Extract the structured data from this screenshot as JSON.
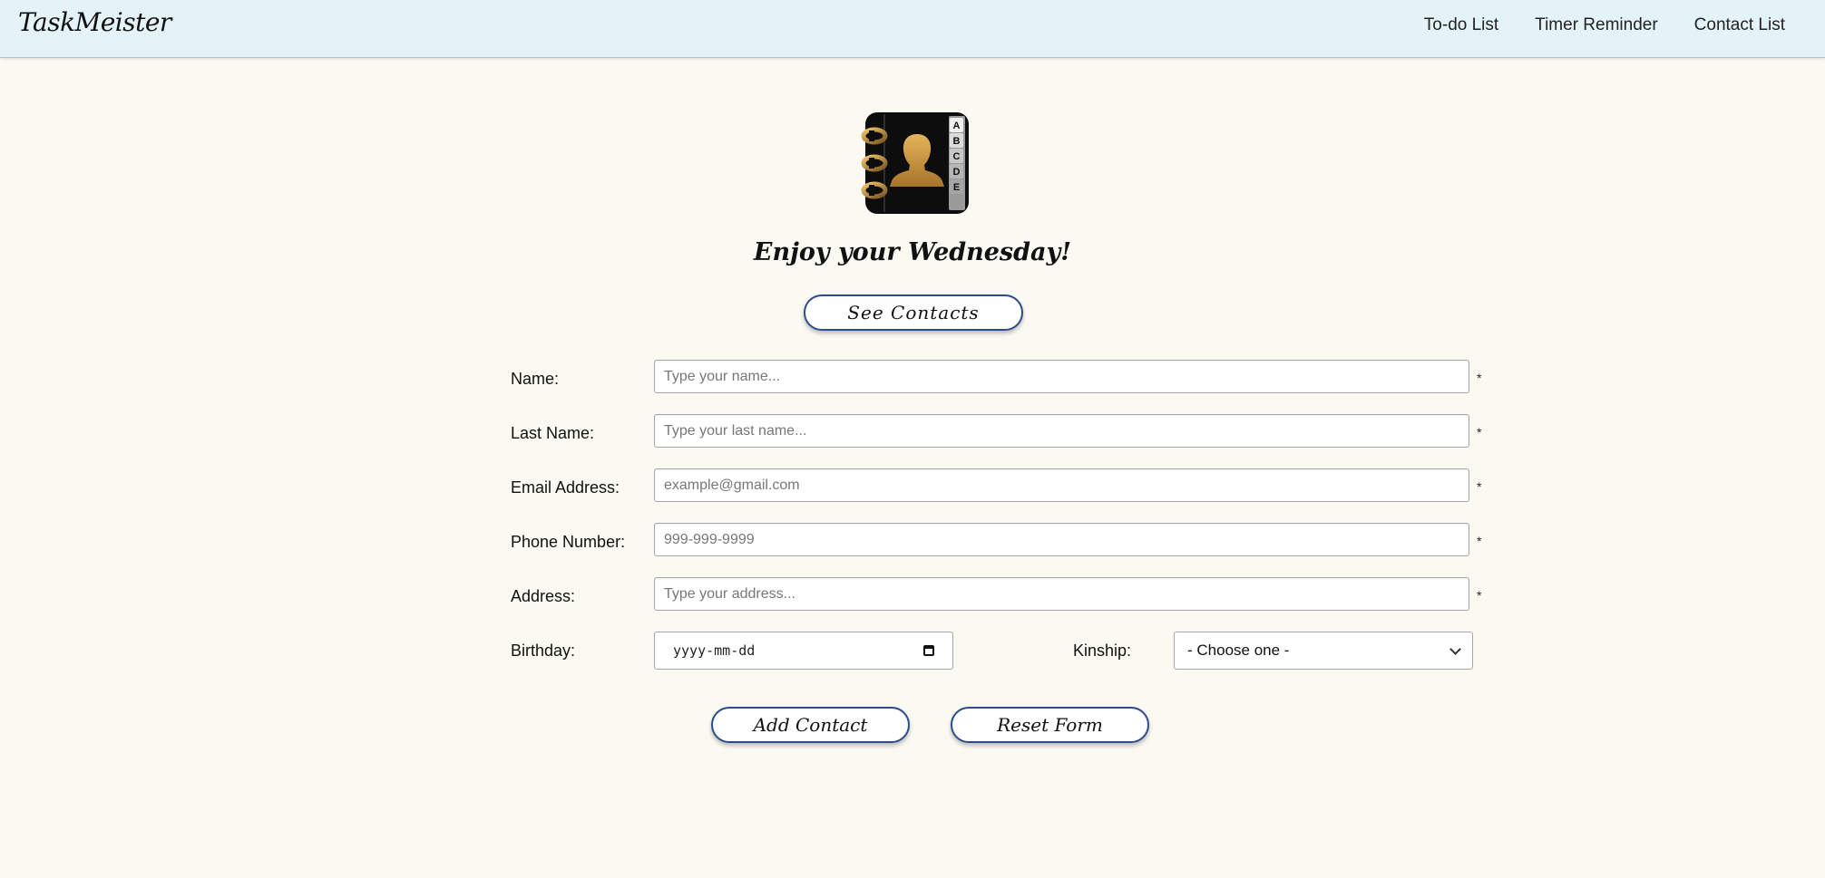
{
  "nav": {
    "brand": "TaskMeister",
    "links": [
      "To-do List",
      "Timer Reminder",
      "Contact List"
    ]
  },
  "greeting": "Enjoy your Wednesday!",
  "buttons": {
    "see_contacts": "See Contacts",
    "add_contact": "Add Contact",
    "reset_form": "Reset Form"
  },
  "logo": {
    "icon": "address-book-icon",
    "tabs": [
      "A",
      "B",
      "C",
      "D",
      "E"
    ]
  },
  "form": {
    "required_mark": "*",
    "name": {
      "label": "Name:",
      "placeholder": "Type your name...",
      "value": ""
    },
    "last_name": {
      "label": "Last Name:",
      "placeholder": "Type your last name...",
      "value": ""
    },
    "email": {
      "label": "Email Address:",
      "placeholder": "example@gmail.com",
      "value": ""
    },
    "phone": {
      "label": "Phone Number:",
      "placeholder": "999-999-9999",
      "value": ""
    },
    "address": {
      "label": "Address:",
      "placeholder": "Type your address...",
      "value": ""
    },
    "birthday": {
      "label": "Birthday:",
      "placeholder": "yyyy-mm-dd"
    },
    "kinship": {
      "label": "Kinship:",
      "selected": "- Choose one -"
    }
  },
  "colors": {
    "navbar_bg": "#e4f3f8",
    "page_bg": "#faf9f2",
    "button_border": "#2b4d8c",
    "logo_gold": "#c6923e"
  }
}
